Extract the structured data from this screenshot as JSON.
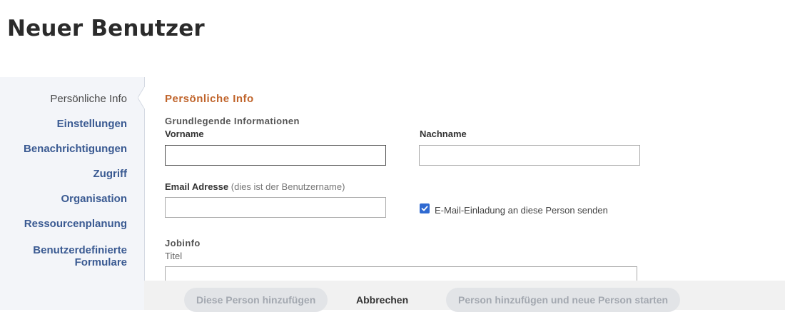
{
  "page": {
    "title": "Neuer Benutzer"
  },
  "sidebar": {
    "items": [
      {
        "label": "Persönliche Info",
        "active": true
      },
      {
        "label": "Einstellungen"
      },
      {
        "label": "Benachrichtigungen"
      },
      {
        "label": "Zugriff"
      },
      {
        "label": "Organisation"
      },
      {
        "label": "Ressourcenplanung"
      },
      {
        "label_line1": "Benutzerdefinierte",
        "label_line2": "Formulare"
      }
    ]
  },
  "form": {
    "section_title": "Persönliche Info",
    "basic_info_heading": "Grundlegende Informationen",
    "first_name": {
      "label": "Vorname",
      "value": ""
    },
    "last_name": {
      "label": "Nachname",
      "value": ""
    },
    "email": {
      "label": "Email Adresse",
      "hint": "(dies ist der Benutzername)",
      "value": ""
    },
    "invite_checkbox": {
      "label": "E-Mail-Einladung an diese Person senden",
      "checked": true
    },
    "job_info_heading": "Jobinfo",
    "job_title": {
      "label": "Titel",
      "value": ""
    }
  },
  "footer": {
    "add_person": "Diese Person hinzufügen",
    "cancel": "Abbrechen",
    "add_and_new": "Person hinzufügen und neue Person starten"
  },
  "colors": {
    "accent_orange": "#c0642b",
    "nav_blue": "#3a5a92",
    "checkbox_blue": "#2f6ad1",
    "sidebar_bg": "#f3f5f9"
  }
}
